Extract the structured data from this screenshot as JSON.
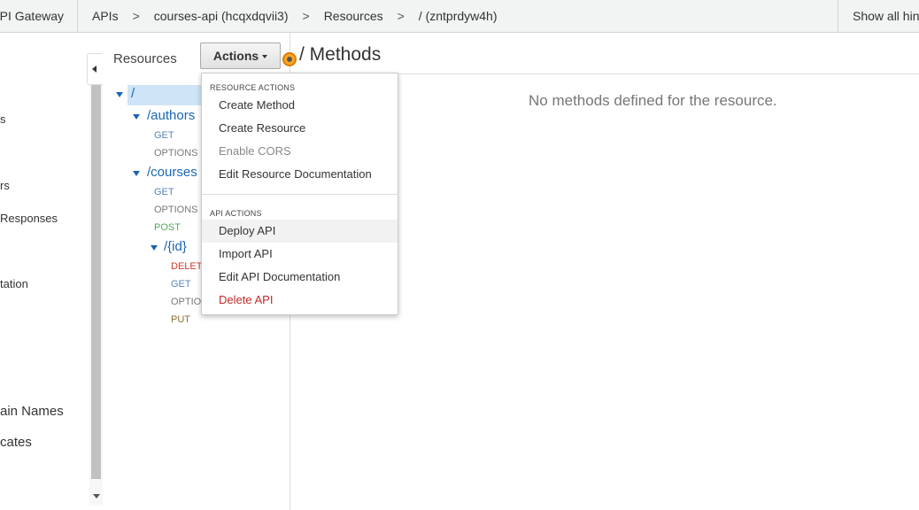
{
  "topbar": {
    "brand": "API Gateway",
    "breadcrumbs": [
      "APIs",
      "courses-api (hcqxdqvii3)",
      "Resources",
      "/ (zntprdyw4h)"
    ],
    "separator": ">",
    "hints": "Show all hints"
  },
  "leftnav": {
    "items": [
      "s",
      "rs",
      "Responses",
      "tation",
      "ain Names",
      "cates"
    ]
  },
  "resources_panel": {
    "title": "Resources",
    "actions_label": "Actions",
    "tree": {
      "root": "/",
      "authors": {
        "label": "/authors",
        "methods": [
          "GET",
          "OPTIONS"
        ]
      },
      "courses": {
        "label": "/courses",
        "methods": [
          "GET",
          "OPTIONS",
          "POST"
        ]
      },
      "id": {
        "label": "/{id}",
        "methods": [
          "DELETE",
          "GET",
          "OPTIONS",
          "PUT"
        ]
      }
    }
  },
  "main": {
    "title": "/ Methods",
    "empty_message": "No methods defined for the resource."
  },
  "actions_menu": {
    "resource_header": "RESOURCE ACTIONS",
    "resource_items": [
      "Create Method",
      "Create Resource",
      "Enable CORS",
      "Edit Resource Documentation"
    ],
    "api_header": "API ACTIONS",
    "api_items": [
      "Deploy API",
      "Import API",
      "Edit API Documentation",
      "Delete API"
    ]
  },
  "colors": {
    "link": "#1a66b3",
    "selected_row": "#cfe4f7",
    "danger": "#c62828",
    "post": "#56a95a",
    "hint_dot": "#f7a823"
  }
}
